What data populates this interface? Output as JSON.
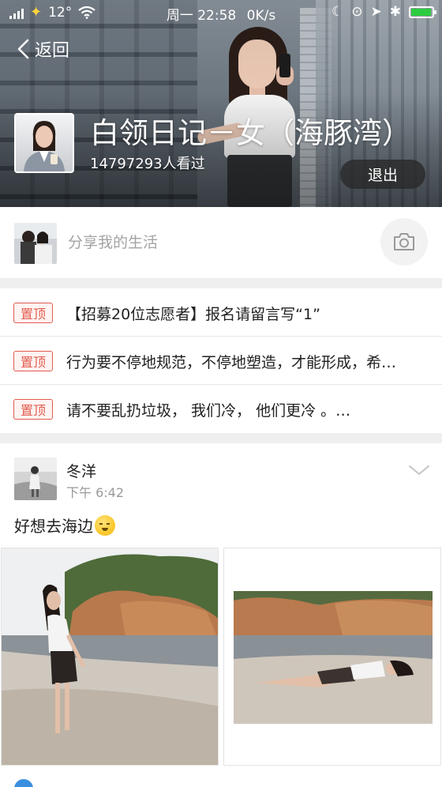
{
  "status_bar": {
    "temperature": "12°",
    "time": "周一 22:58",
    "network_speed": "0K/s",
    "battery_level": 0.95,
    "battery_color": "#2ecc40"
  },
  "header": {
    "back_label": "返回",
    "group_title": "白领日记－女（海豚湾）",
    "view_count": "14797293人看过",
    "exit_label": "退出"
  },
  "compose": {
    "placeholder": "分享我的生活",
    "camera_icon": "camera-icon"
  },
  "pinned": {
    "tag_label": "置顶",
    "tag_color": "#e25b4f",
    "items": [
      {
        "text": "【招募20位志愿者】报名请留言写“1”"
      },
      {
        "text": "行为要不停地规范，不停地塑造，才能形成，希…"
      },
      {
        "text": "请不要乱扔垃圾，  我们冷，  他们更冷  。…"
      }
    ]
  },
  "post": {
    "author": "冬洋",
    "time": "下午 6:42",
    "text": "好想去海边",
    "emoji": "smiling-face-emoji"
  }
}
